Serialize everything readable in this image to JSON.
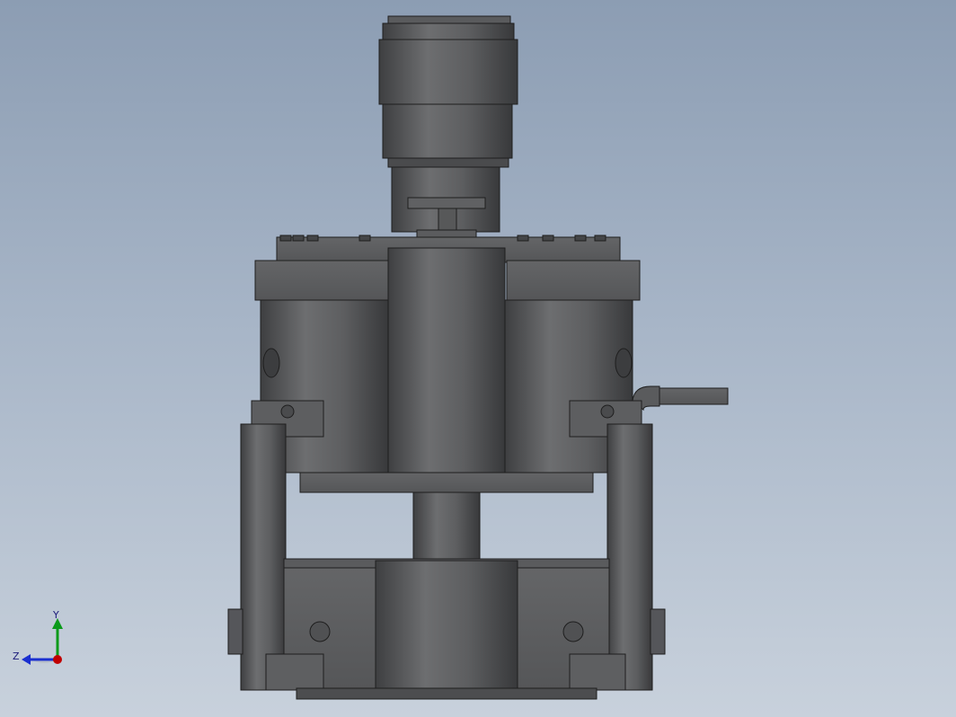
{
  "viewport": {
    "background_top": "#8c9db3",
    "background_bottom": "#c8d1dc",
    "model_color": "#5c5d5f",
    "edge_color": "#1e1e1e"
  },
  "triad": {
    "x_axis_color": "#c00000",
    "y_axis_color": "#0a9a1a",
    "z_axis_color": "#1a2fd0",
    "y_label": "Y",
    "z_label": "Z"
  }
}
